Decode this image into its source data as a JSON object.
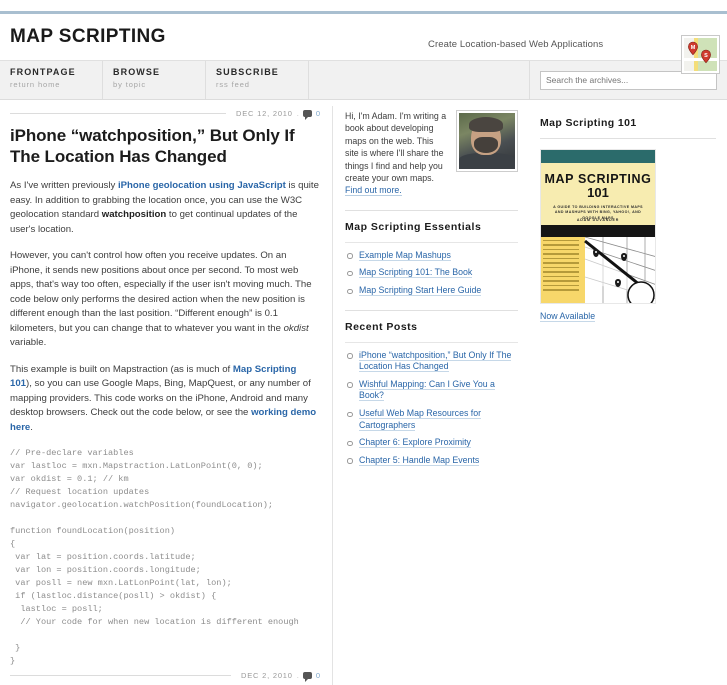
{
  "site": {
    "brand": "MAP SCRIPTING",
    "tagline": "Create Location-based Web Applications",
    "logo_icon": "map-pins-logo"
  },
  "nav": {
    "items": [
      {
        "title": "FRONTPAGE",
        "sub": "return home"
      },
      {
        "title": "BROWSE",
        "sub": "by topic"
      },
      {
        "title": "SUBSCRIBE",
        "sub": "rss feed"
      }
    ],
    "search": {
      "placeholder": "Search the archives...",
      "value": ""
    }
  },
  "post": {
    "meta": {
      "date": "DEC 12, 2010",
      "separator": ".",
      "comment_count": "0",
      "comment_icon": "comment-bubble-icon"
    },
    "title": "iPhone “watchposition,” But Only If The Location Has Changed",
    "paragraph1": {
      "pre": "As I've written previously ",
      "link": "iPhone geolocation using JavaScript",
      "mid": " is quite easy. In addition to grabbing the location once, you can use the W3C geolocation standard ",
      "bold": "watchposition",
      "post": " to get continual updates of the user's location."
    },
    "paragraph2": {
      "pre": "However, you can't control how often you receive updates. On an iPhone, it sends new positions about once per second. To most web apps, that's way too often, especially if the user isn't moving much. The code below only performs the desired action when the new position is different enough than the last position. “Different enough” is 0.1 kilometers, but you can change that to whatever you want in the ",
      "italic": "okdist",
      "post": " variable."
    },
    "paragraph3": {
      "pre": "This example is built on Mapstraction (as is much of ",
      "link1": "Map Scripting 101",
      "mid": "), so you can use Google Maps, Bing, MapQuest, or any number of mapping providers. This code works on the iPhone, Android and many desktop browsers. Check out the code below, or see the ",
      "link2": "working demo here",
      "post": "."
    },
    "code": "// Pre-declare variables\nvar lastloc = mxn.Mapstraction.LatLonPoint(0, 0);\nvar okdist = 0.1; // km\n// Request location updates\nnavigator.geolocation.watchPosition(foundLocation);\n\nfunction foundLocation(position)\n{\n var lat = position.coords.latitude;\n var lon = position.coords.longitude;\n var posll = new mxn.LatLonPoint(lat, lon);\n if (lastloc.distance(posll) > okdist) {\n  lastloc = posll;\n  // Your code for when new location is different enough\n\n }\n}"
  },
  "next_post": {
    "meta": {
      "date": "DEC 2, 2010",
      "separator": ".",
      "comment_count": "0",
      "comment_icon": "comment-bubble-icon"
    }
  },
  "bio": {
    "text_pre": "Hi, I'm Adam. I'm writing a book about developing maps on the web. This site is where I'll share the things I find and help you create your own maps. ",
    "link": "Find out more.",
    "avatar_alt": "author-photo"
  },
  "essentials": {
    "heading": "Map Scripting Essentials",
    "links": [
      "Example Map Mashups",
      "Map Scripting 101: The Book",
      "Map Scripting Start Here Guide"
    ]
  },
  "recent": {
    "heading": "Recent Posts",
    "links": [
      "iPhone “watchposition,” But Only If The Location Has Changed",
      "Wishful Mapping: Can I Give You a Book?",
      "Useful Web Map Resources for Cartographers",
      "Chapter 6: Explore Proximity",
      "Chapter 5: Handle Map Events"
    ]
  },
  "book": {
    "heading": "Map Scripting 101",
    "cover": {
      "title_line1": "MAP SCRIPTING",
      "title_line2": "101",
      "subtitle": "A GUIDE TO BUILDING INTERACTIVE MAPS AND MASHUPS WITH BING, YAHOO!, AND GOOGLE MAPS",
      "author": "ADAM DUVANDER"
    },
    "cta": "Now Available"
  },
  "colors": {
    "accent_link": "#2a66a8",
    "top_rule": "#a9bfd0",
    "nav_bg": "#f1f1f1",
    "book_teal": "#2b6b6b",
    "book_yellow": "#f7d76a",
    "pin_red": "#d93b2b"
  }
}
